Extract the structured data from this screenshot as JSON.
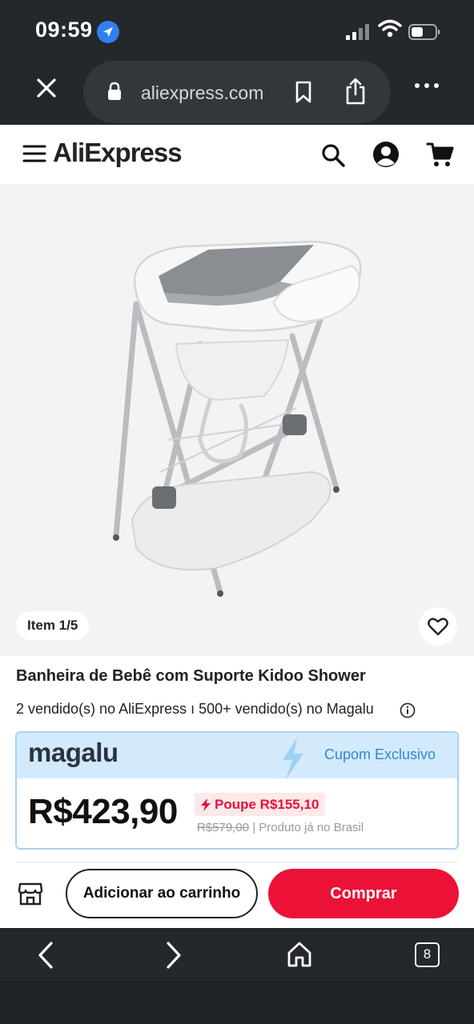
{
  "status_bar": {
    "time": "09:59"
  },
  "browser": {
    "url": "aliexpress.com",
    "tab_count": "8"
  },
  "site": {
    "logo": "AliExpress",
    "brand_color": "#e8113a",
    "logo_accent": "#f7b500"
  },
  "gallery": {
    "counter": "Item 1/5"
  },
  "product": {
    "title": "Banheira de Bebê com Suporte Kidoo Shower",
    "sold": "2 vendido(s) no AliExpress ı 500+ vendido(s) no Magalu"
  },
  "coupon": {
    "brand": "Magalu",
    "label": "Cupom Exclusivo",
    "price": "R$423,90",
    "saving": "Poupe R$155,10",
    "old_price": "R$579,00",
    "note": " | Produto já no Brasil"
  },
  "actions": {
    "add_to_cart": "Adicionar ao carrinho",
    "buy": "Comprar"
  }
}
